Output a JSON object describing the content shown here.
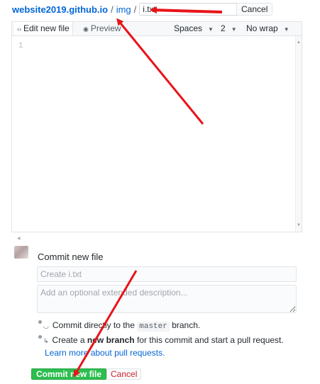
{
  "breadcrumb": {
    "repo": "website2019.github.io",
    "separator": "/",
    "folder": "img",
    "filename_value": "i.txt"
  },
  "header": {
    "cancel_label": "Cancel"
  },
  "editor": {
    "tab_edit_label": "Edit new file",
    "tab_preview_label": "Preview",
    "indent_mode": "Spaces",
    "indent_size": "2",
    "wrap_mode": "No wrap",
    "line_numbers": [
      "1"
    ]
  },
  "commit": {
    "heading": "Commit new file",
    "summary_placeholder": "Create i.txt",
    "description_placeholder": "Add an optional extended description...",
    "option_direct_prefix": "Commit directly to the",
    "option_direct_branch": "master",
    "option_direct_suffix": "branch.",
    "option_new_prefix": "Create a",
    "option_new_bold": "new branch",
    "option_new_suffix": "for this commit and start a pull request.",
    "learn_more": "Learn more about pull requests.",
    "commit_button": "Commit new file",
    "cancel_button": "Cancel"
  },
  "icons": {
    "edit_tab": "code-icon",
    "preview_tab": "eye-icon",
    "option_direct": "commit-icon",
    "option_new": "branch-icon"
  },
  "colors": {
    "link": "#0366d6",
    "commit_button": "#2cbe4e",
    "cancel_text": "#cb2431",
    "annotation_arrow": "#e8141a"
  }
}
